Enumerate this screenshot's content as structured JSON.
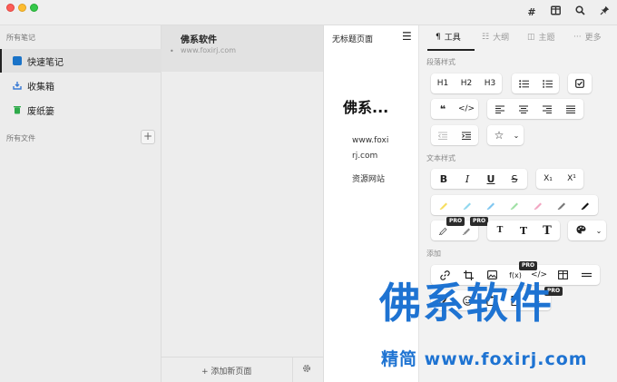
{
  "titlebar": {
    "icons": [
      "hash-icon",
      "columns-icon",
      "search-icon",
      "pin-icon"
    ],
    "hash_glyph": "#"
  },
  "sidebar": {
    "section_notes": "所有笔记",
    "items": [
      {
        "label": "快速笔记",
        "icon": "note-icon",
        "color": "#1a73c8"
      },
      {
        "label": "收集箱",
        "icon": "inbox-icon",
        "color": "#3a7bd5"
      },
      {
        "label": "废纸篓",
        "icon": "trash-icon",
        "color": "#2eaa4a"
      }
    ],
    "section_files": "所有文件",
    "add_glyph": "+"
  },
  "notelist": {
    "note_title": "佛系软件",
    "note_sub": "www.foxirj.com",
    "add_page": "+ 添加新页面"
  },
  "editor": {
    "title": "无标题页面",
    "heading": "佛系...",
    "lines": [
      "www.foxi",
      "rj.com",
      "资源网站"
    ]
  },
  "tools": {
    "tabs": [
      {
        "label": "工具",
        "glyph": "¶"
      },
      {
        "label": "大纲",
        "glyph": "☷"
      },
      {
        "label": "主题",
        "glyph": "◫"
      },
      {
        "label": "更多",
        "glyph": "···"
      }
    ],
    "sec_paragraph": "段落样式",
    "sec_text": "文本样式",
    "sec_add": "添加",
    "headings": [
      "H1",
      "H2",
      "H3"
    ],
    "code_glyph": "</>",
    "text_styles": [
      "B",
      "I",
      "U",
      "S"
    ],
    "sub": "X₁",
    "sup": "X¹",
    "font_sizes": [
      "T",
      "T",
      "T"
    ],
    "pro": "PRO",
    "func_glyph": "f(x)"
  },
  "watermark": {
    "big": "佛系软件",
    "small": "精简 www.foxirj.com",
    "color": "#1e73d2"
  }
}
